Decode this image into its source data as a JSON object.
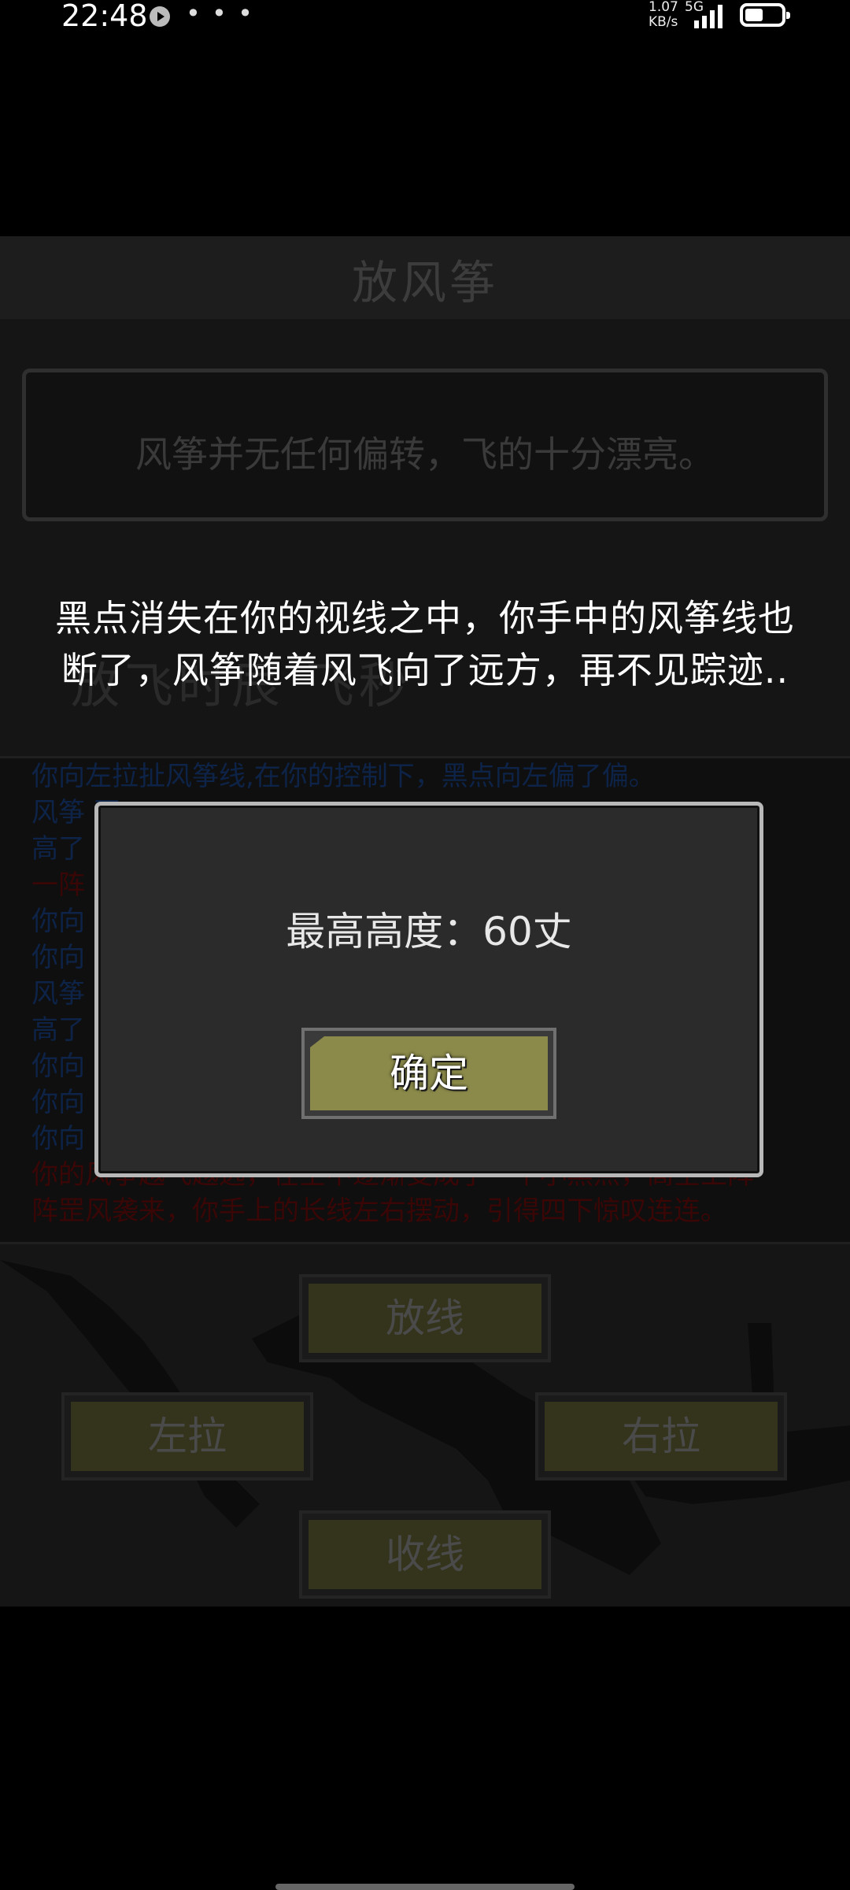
{
  "status_bar": {
    "time": "22:48",
    "more": "• • •",
    "net_speed": "1.07\nKB/s",
    "network": "5G",
    "icons": [
      "play-icon",
      "signal-icon",
      "battery-icon"
    ]
  },
  "game": {
    "title": "放风筝",
    "message": "风筝并无任何偏转，飞的十分漂亮。",
    "shadow_text": "放飞时辰 飞秒",
    "log": [
      {
        "text": "你向左拉扯风筝线,在你的控制下，黑点向左偏了偏。",
        "color": "blue"
      },
      {
        "text": "风筝                                                                                      再",
        "color": "blue"
      },
      {
        "text": "高了",
        "color": "blue"
      },
      {
        "text": "一阵",
        "color": "red"
      },
      {
        "text": "你向",
        "color": "blue"
      },
      {
        "text": "你向",
        "color": "blue"
      },
      {
        "text": "风筝                                                                                      再",
        "color": "blue"
      },
      {
        "text": "高了",
        "color": "blue"
      },
      {
        "text": "你向",
        "color": "blue"
      },
      {
        "text": "你向",
        "color": "blue"
      },
      {
        "text": "你向",
        "color": "blue"
      },
      {
        "text": "你的风筝越飞越远，在空中逐渐变成了一个小黑点，高空上阵",
        "color": "red"
      },
      {
        "text": "阵罡风袭来，你手上的长线左右摆动，引得四下惊叹连连。",
        "color": "red"
      }
    ],
    "buttons": {
      "release": "放线",
      "left": "左拉",
      "right": "右拉",
      "reel": "收线"
    }
  },
  "overlay": {
    "caption_line1": "黑点消失在你的视线之中，你手中的风筝线也",
    "caption_line2": "断了，风筝随着风飞向了远方，再不见踪迹.."
  },
  "dialog": {
    "text": "最高高度：60丈",
    "confirm": "确定"
  },
  "colors": {
    "dialog_bg": "#2b2b2b",
    "dialog_border": "#b8b8b8",
    "button_fill": "#8b8a4a",
    "log_blue": "#0d2347",
    "log_red": "#3a0606"
  }
}
